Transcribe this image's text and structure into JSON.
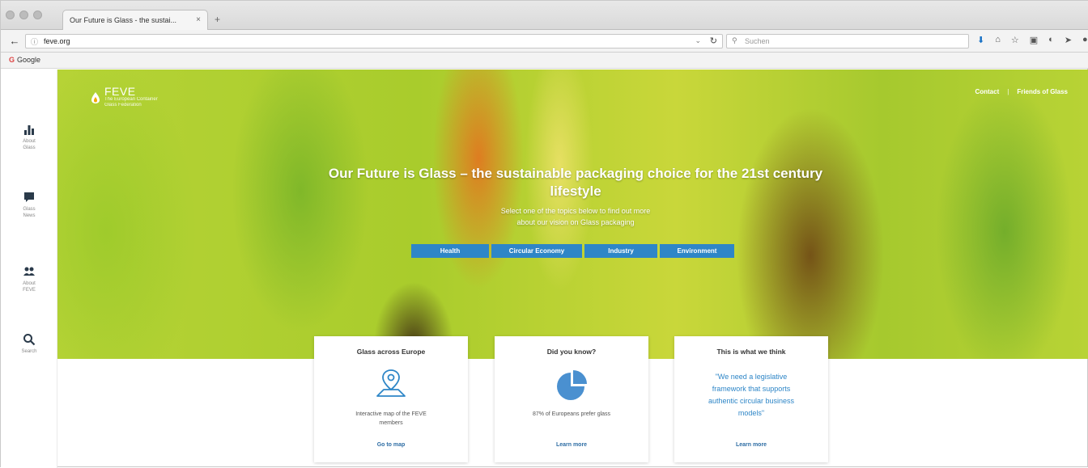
{
  "browser": {
    "tab_title": "Our Future is Glass - the sustai...",
    "tab_close": "×",
    "new_tab": "+",
    "url": "feve.org",
    "search_placeholder": "Suchen",
    "bookmark": "Google",
    "accent": "#1b73c6"
  },
  "site": {
    "logo_name": "FEVE",
    "logo_sub_1": "The European Container",
    "logo_sub_2": "Glass Federation",
    "nav": {
      "contact": "Contact",
      "sep": "|",
      "friends": "Friends of Glass"
    }
  },
  "rail": [
    {
      "icon": "bar-chart-icon",
      "label_1": "About",
      "label_2": "Glass"
    },
    {
      "icon": "chat-bubble-icon",
      "label_1": "Glass",
      "label_2": "News"
    },
    {
      "icon": "people-icon",
      "label_1": "About",
      "label_2": "FEVE"
    },
    {
      "icon": "search-icon",
      "label_1": "Search",
      "label_2": ""
    }
  ],
  "hero": {
    "title_1": "Our Future is Glass – the sustainable packaging choice for the 21st century",
    "title_2": "lifestyle",
    "sub_1": "Select one of the topics below to find out more",
    "sub_2": "about our vision on Glass packaging",
    "topics": [
      "Health",
      "Circular Economy",
      "Industry",
      "Environment"
    ],
    "topic_color": "#2e86c7"
  },
  "cards": [
    {
      "title": "Glass across Europe",
      "icon": "map-pin-icon",
      "text_1": "Interactive map of the FEVE",
      "text_2": "members",
      "link": "Go to map"
    },
    {
      "title": "Did you know?",
      "icon": "pie-chart-icon",
      "text_1": "87% of Europeans prefer glass",
      "link": "Learn more"
    },
    {
      "title": "This is what we think",
      "quote_1": "\"We need a legislative",
      "quote_2": "framework that supports",
      "quote_3": "authentic circular business",
      "quote_4": "models\"",
      "link": "Learn more"
    }
  ]
}
